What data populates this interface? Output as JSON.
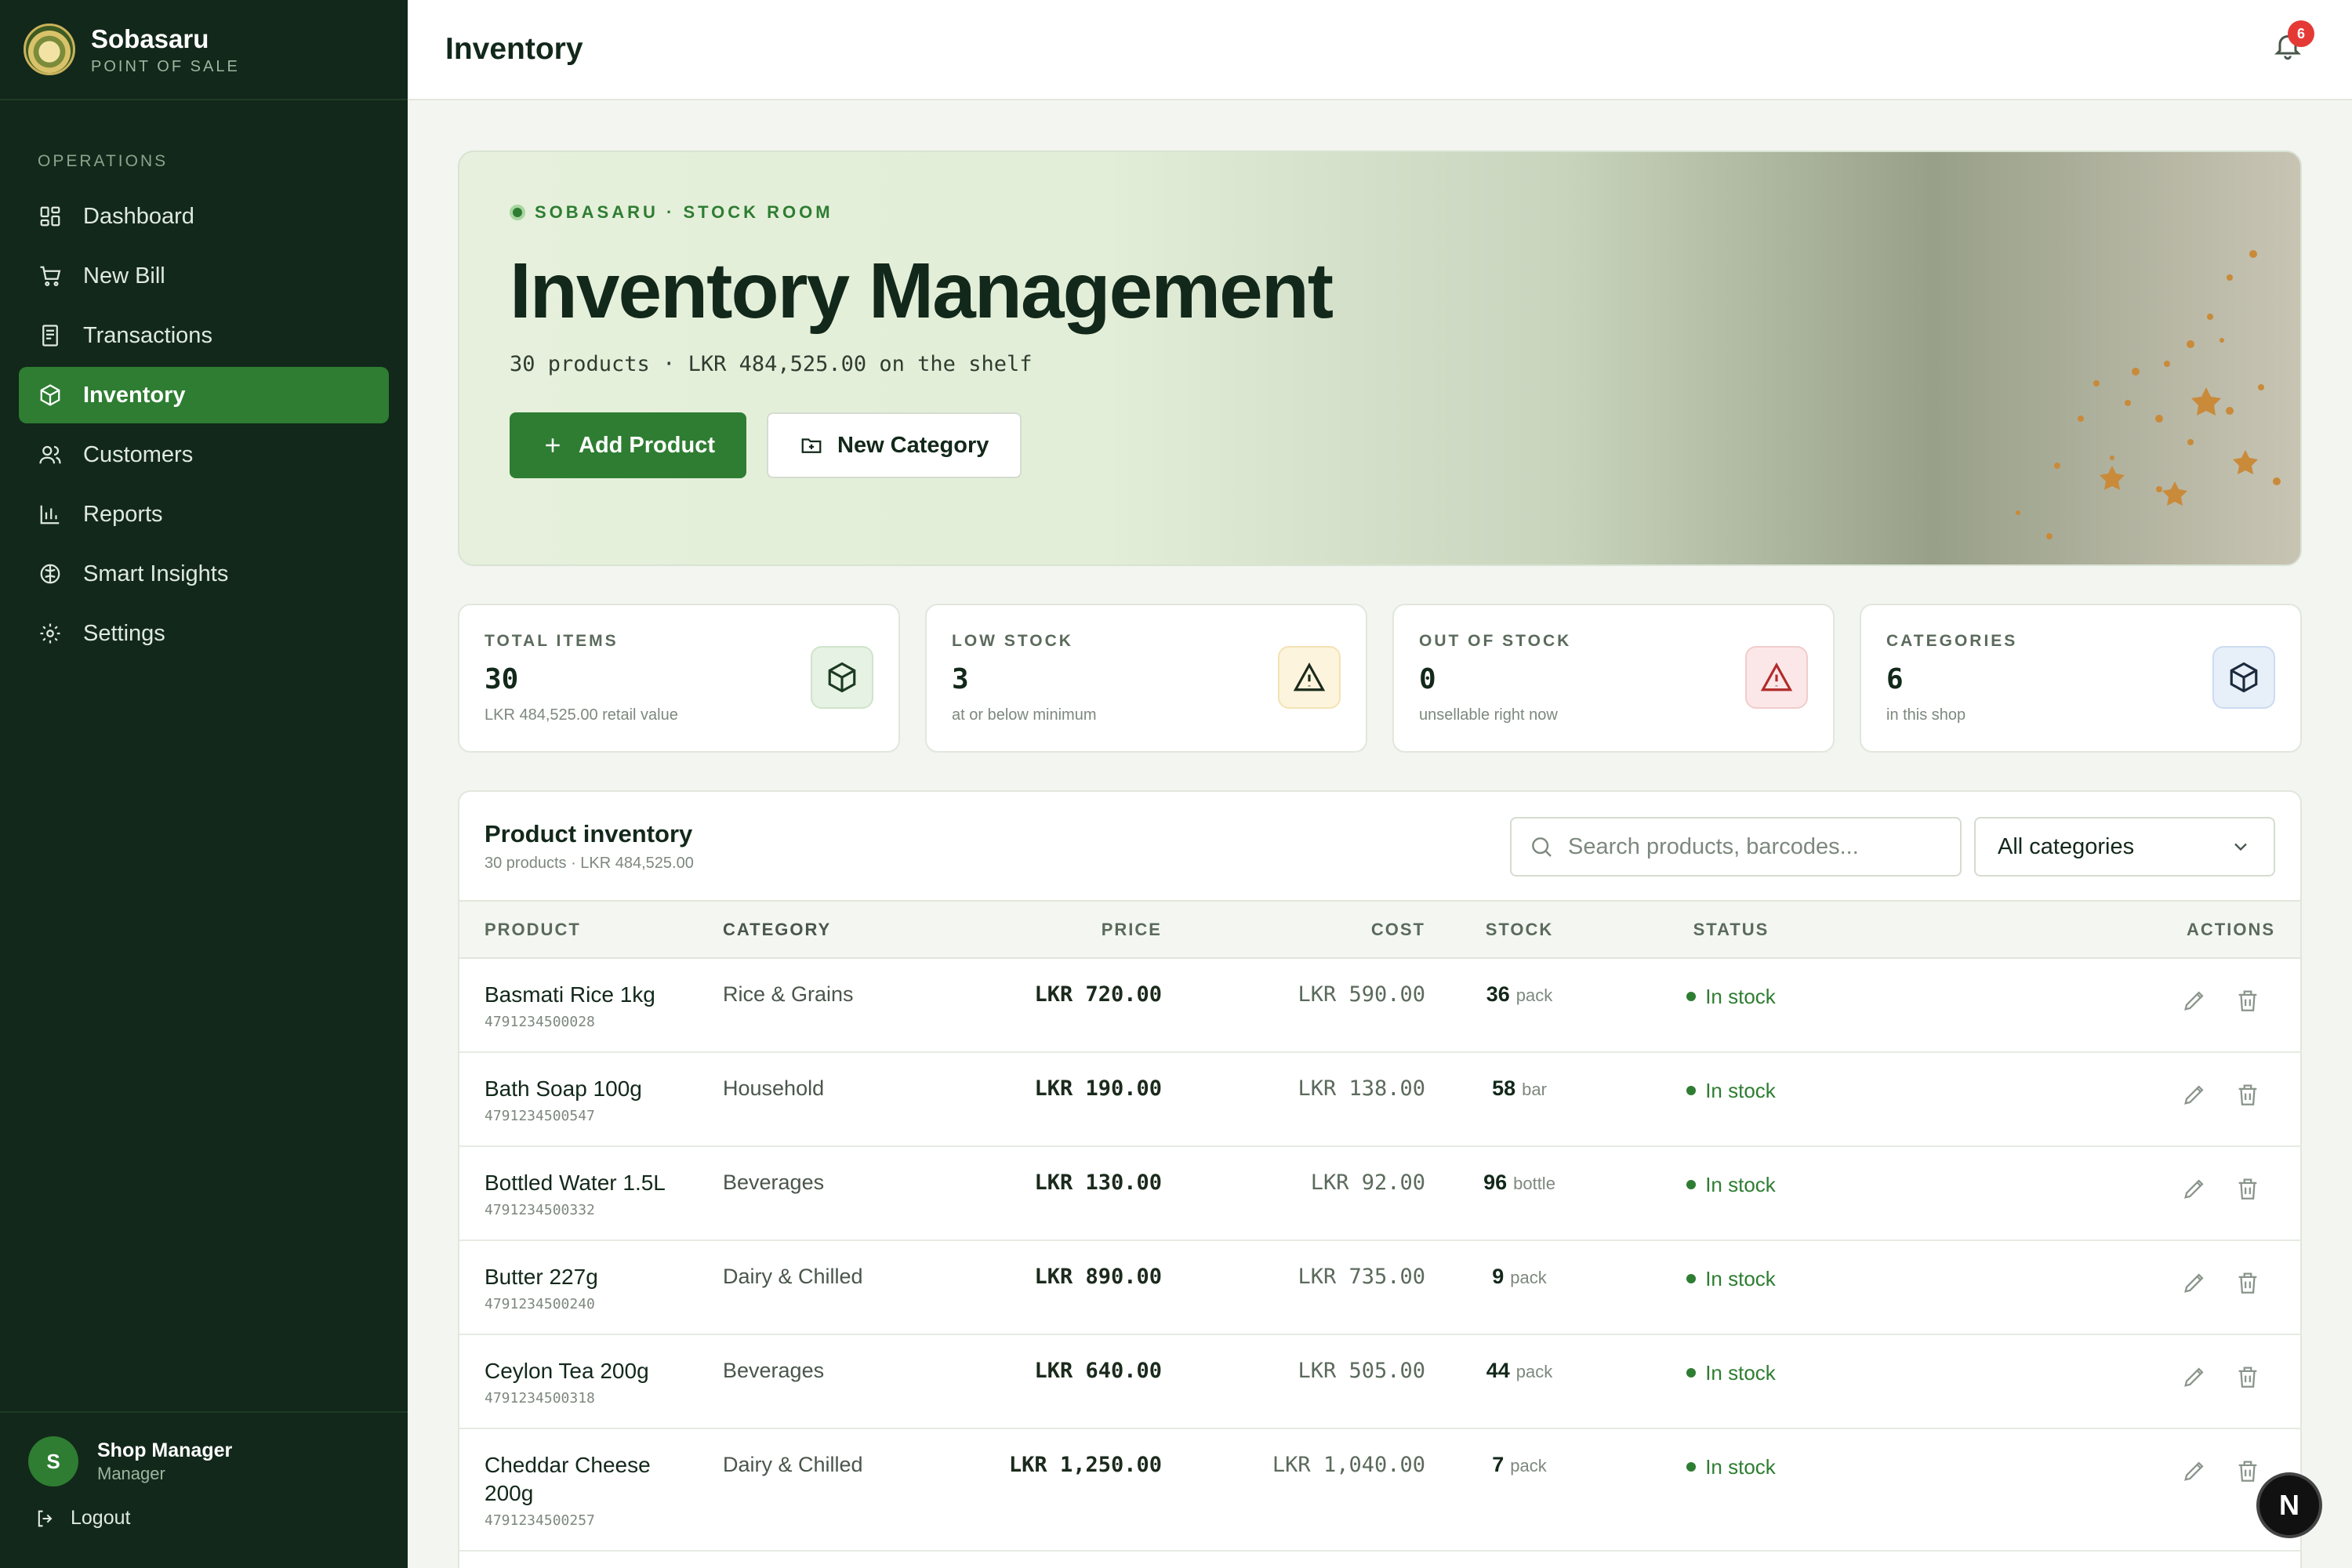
{
  "brand": {
    "name": "Sobasaru",
    "subtitle": "POINT OF SALE"
  },
  "sidebar": {
    "section_title": "OPERATIONS",
    "items": [
      {
        "label": "Dashboard",
        "icon": "dashboard-icon"
      },
      {
        "label": "New Bill",
        "icon": "cart-icon"
      },
      {
        "label": "Transactions",
        "icon": "receipt-icon"
      },
      {
        "label": "Inventory",
        "icon": "box-icon",
        "active": true
      },
      {
        "label": "Customers",
        "icon": "users-icon"
      },
      {
        "label": "Reports",
        "icon": "bar-chart-icon"
      },
      {
        "label": "Smart Insights",
        "icon": "brain-icon"
      },
      {
        "label": "Settings",
        "icon": "gear-icon"
      }
    ],
    "user": {
      "initial": "S",
      "name": "Shop Manager",
      "role": "Manager"
    },
    "logout_label": "Logout"
  },
  "header": {
    "title": "Inventory",
    "notifications": "6"
  },
  "hero": {
    "eyebrow": "SOBASARU · STOCK ROOM",
    "title": "Inventory Management",
    "subtitle": "30 products · LKR 484,525.00 on the shelf",
    "add_product_label": "Add Product",
    "new_category_label": "New Category"
  },
  "stats": [
    {
      "label": "TOTAL ITEMS",
      "value": "30",
      "note": "LKR 484,525.00 retail value",
      "icon": "box-icon",
      "color": "#2e7d32"
    },
    {
      "label": "LOW STOCK",
      "value": "3",
      "note": "at or below minimum",
      "icon": "warning-icon",
      "color": "#e6a817"
    },
    {
      "label": "OUT OF STOCK",
      "value": "0",
      "note": "unsellable right now",
      "icon": "warning-icon",
      "color": "#d93a3a"
    },
    {
      "label": "CATEGORIES",
      "value": "6",
      "note": "in this shop",
      "icon": "box-icon",
      "color": "#3a6fb0"
    }
  ],
  "table": {
    "title": "Product inventory",
    "subtitle": "30 products · LKR 484,525.00",
    "search_placeholder": "Search products, barcodes...",
    "category_filter": "All categories",
    "columns": [
      "PRODUCT",
      "CATEGORY",
      "PRICE",
      "COST",
      "STOCK",
      "STATUS",
      "ACTIONS"
    ],
    "rows": [
      {
        "name": "Basmati Rice 1kg",
        "code": "4791234500028",
        "category": "Rice & Grains",
        "price": "LKR 720.00",
        "cost": "LKR 590.00",
        "stock": "36",
        "unit": "pack",
        "status": "In stock"
      },
      {
        "name": "Bath Soap 100g",
        "code": "4791234500547",
        "category": "Household",
        "price": "LKR 190.00",
        "cost": "LKR 138.00",
        "stock": "58",
        "unit": "bar",
        "status": "In stock"
      },
      {
        "name": "Bottled Water 1.5L",
        "code": "4791234500332",
        "category": "Beverages",
        "price": "LKR 130.00",
        "cost": "LKR 92.00",
        "stock": "96",
        "unit": "bottle",
        "status": "In stock"
      },
      {
        "name": "Butter 227g",
        "code": "4791234500240",
        "category": "Dairy & Chilled",
        "price": "LKR 890.00",
        "cost": "LKR 735.00",
        "stock": "9",
        "unit": "pack",
        "status": "In stock"
      },
      {
        "name": "Ceylon Tea 200g",
        "code": "4791234500318",
        "category": "Beverages",
        "price": "LKR 640.00",
        "cost": "LKR 505.00",
        "stock": "44",
        "unit": "pack",
        "status": "In stock"
      },
      {
        "name": "Cheddar Cheese 200g",
        "code": "4791234500257",
        "category": "Dairy & Chilled",
        "price": "LKR 1,250.00",
        "cost": "LKR 1,040.00",
        "stock": "7",
        "unit": "pack",
        "status": "In stock"
      }
    ]
  },
  "fab_label": "N"
}
